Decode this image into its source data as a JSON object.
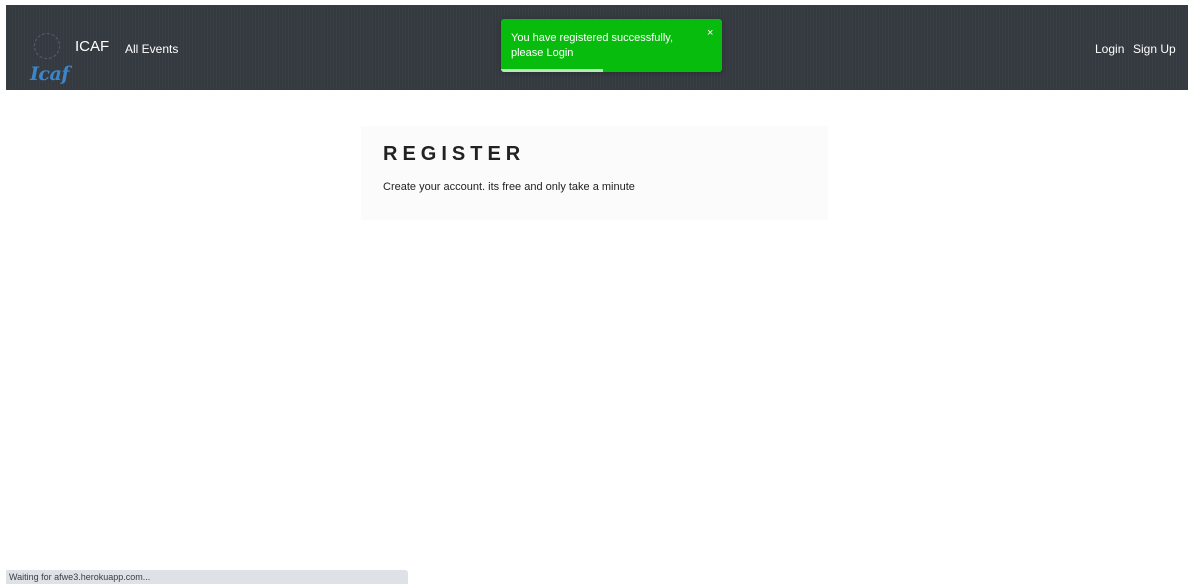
{
  "navbar": {
    "logo_text": "Icaf",
    "brand": "ICAF",
    "links": {
      "all_events": "All Events",
      "login": "Login",
      "signup": "Sign Up"
    },
    "background_color": "#343a40"
  },
  "toast": {
    "message": "You have registered successfully, please Login",
    "close_icon": "×",
    "color": "#07bc0c",
    "progress_percent": 46
  },
  "register": {
    "title": "REGISTER",
    "subtitle": "Create your account. its free and only take a minute"
  },
  "status_bar": {
    "text": "Waiting for afwe3.herokuapp.com..."
  }
}
